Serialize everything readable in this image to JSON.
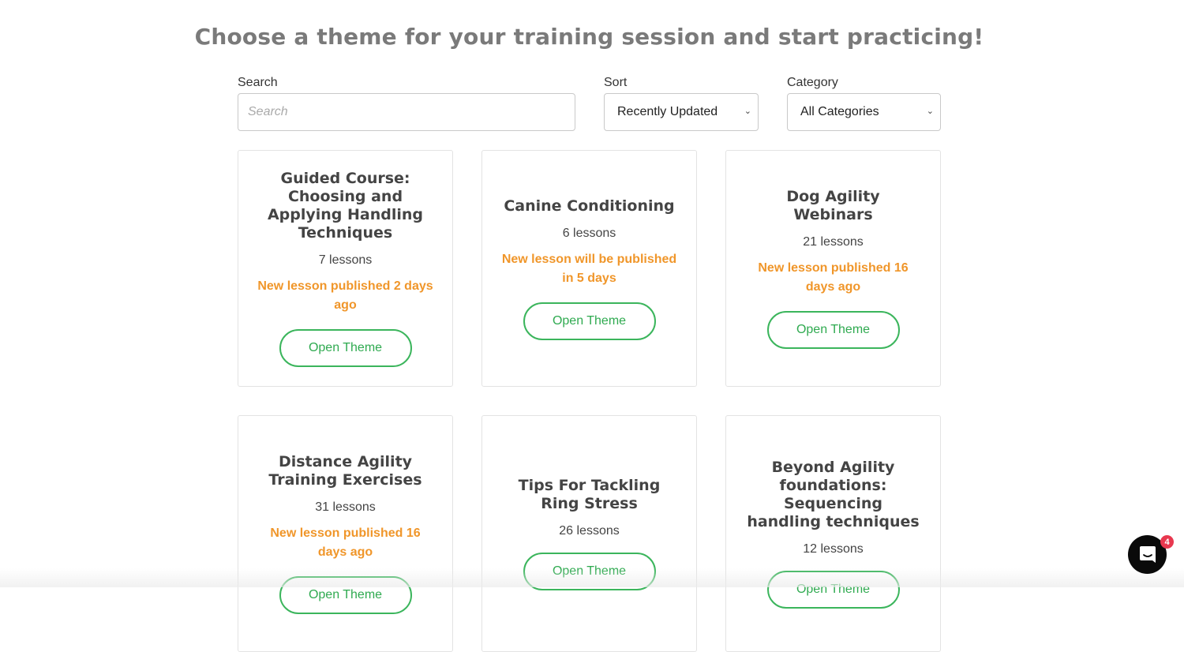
{
  "header": {
    "title": "Choose a theme for your training session and start practicing!"
  },
  "filters": {
    "search_label": "Search",
    "search_placeholder": "Search",
    "sort_label": "Sort",
    "sort_value": "Recently Updated",
    "category_label": "Category",
    "category_value": "All Categories"
  },
  "themes": [
    {
      "title": "Guided Course: Choosing and Applying Handling Techniques",
      "lessons": "7 lessons",
      "update": "New lesson published 2 days ago",
      "button": "Open Theme"
    },
    {
      "title": "Canine Conditioning",
      "lessons": "6 lessons",
      "update": "New lesson will be published in 5 days",
      "button": "Open Theme"
    },
    {
      "title": "Dog Agility Webinars",
      "lessons": "21 lessons",
      "update": "New lesson published 16 days ago",
      "button": "Open Theme"
    },
    {
      "title": "Distance Agility Training Exercises",
      "lessons": "31 lessons",
      "update": "New lesson published 16 days ago",
      "button": "Open Theme"
    },
    {
      "title": "Tips For Tackling Ring Stress",
      "lessons": "26 lessons",
      "update": "",
      "button": "Open Theme"
    },
    {
      "title": "Beyond Agility foundations: Sequencing handling techniques",
      "lessons": "12 lessons",
      "update": "",
      "button": "Open Theme"
    }
  ],
  "chat": {
    "icon": "chat-bubble-icon",
    "badge_count": "4"
  },
  "colors": {
    "accent_green": "#3bb55c",
    "update_orange": "#f0962a",
    "badge_red": "#e8384f"
  }
}
